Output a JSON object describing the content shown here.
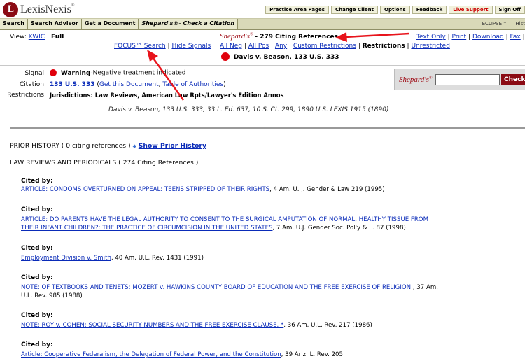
{
  "header": {
    "logo_initial": "L",
    "logo_text": "LexisNexis",
    "logo_tm": "®",
    "top_links": [
      "Practice Area Pages",
      "Change Client",
      "Options",
      "Feedback",
      "Live Support",
      "Sign Off"
    ]
  },
  "nav": {
    "tabs": [
      "Search",
      "Search Advisor",
      "Get a Document",
      "Shepard's®- Check a Citation"
    ],
    "eclipse": "ECLIPSE™",
    "hist": "Hist"
  },
  "view": {
    "label": "View:",
    "kwic": "KWIC",
    "sep": "|",
    "full": "Full"
  },
  "shepards": {
    "logo": "Shepard's",
    "logo_mark": "®",
    "summary": "- 279 Citing References",
    "focus": "FOCUS™ Search",
    "hide_signals": "Hide Signals",
    "filters": [
      "All Neg",
      "All Pos",
      "Any",
      "Custom Restrictions"
    ],
    "restrictions_label": "Restrictions",
    "unrestricted": "Unrestricted",
    "case": "Davis v. Beason, 133 U.S. 333",
    "right_links": [
      "Text Only",
      "Print",
      "Download",
      "Fax",
      "Em"
    ]
  },
  "details": {
    "signal_label": "Signal:",
    "signal_bold": "Warning",
    "signal_text": "-Negative treatment indicated",
    "citation_label": "Citation:",
    "citation_link": "133 U.S. 333",
    "get_doc": "Get this Document",
    "toa": "Table of Authorities",
    "restrictions_label": "Restrictions:",
    "restrictions_text": "Jurisdictions: Law Reviews, American Law Rpts/Lawyer's Edition Annos",
    "full_cite": "Davis v. Beason, 133 U.S. 333, 33 L. Ed. 637, 10 S. Ct. 299, 1890 U.S. LEXIS 1915 (1890)"
  },
  "search_box": {
    "button": "Check"
  },
  "prior_history": {
    "label": "PRIOR HISTORY ( 0 citing references )",
    "bullet": "◆",
    "link": "Show Prior History"
  },
  "law_reviews": {
    "label": "LAW REVIEWS AND PERIODICALS ( 274 Citing References )",
    "cited_by": "Cited by:",
    "entries": [
      {
        "link": "ARTICLE: CONDOMS OVERTURNED ON APPEAL: TEENS STRIPPED OF THEIR RIGHTS",
        "rest": ", 4 Am. U. J. Gender & Law 219 (1995)"
      },
      {
        "link": "ARTICLE: DO PARENTS HAVE THE LEGAL AUTHORITY TO CONSENT TO THE SURGICAL AMPUTATION OF NORMAL, HEALTHY TISSUE FROM",
        "link2": "THEIR INFANT CHILDREN?: THE PRACTICE OF CIRCUMCISION IN THE UNITED STATES",
        "rest": ", 7 Am. U.J. Gender Soc. Pol'y & L. 87 (1998)"
      },
      {
        "link": "Employment Division v. Smith",
        "rest": ", 40 Am. U.L. Rev. 1431 (1991)"
      },
      {
        "link": "NOTE: OF TEXTBOOKS AND TENETS: MOZERT v. HAWKINS COUNTY BOARD OF EDUCATION AND THE FREE EXERCISE OF RELIGION.",
        "rest": ", 37 Am.",
        "rest2": "U.L. Rev. 985 (1988)"
      },
      {
        "link": "NOTE: ROY v. COHEN: SOCIAL SECURITY NUMBERS AND THE FREE EXERCISE CLAUSE. *",
        "rest": ", 36 Am. U.L. Rev. 217 (1986)"
      },
      {
        "link": "Article: Cooperative Federalism, the Delegation of Federal Power, and the Constitution",
        "rest": ", 39 Ariz. L. Rev. 205"
      }
    ]
  },
  "colors": {
    "brand": "#8b0b14",
    "link": "#0a2bb8",
    "warning": "#e0000b",
    "annotation_arrow": "#e8141c"
  }
}
